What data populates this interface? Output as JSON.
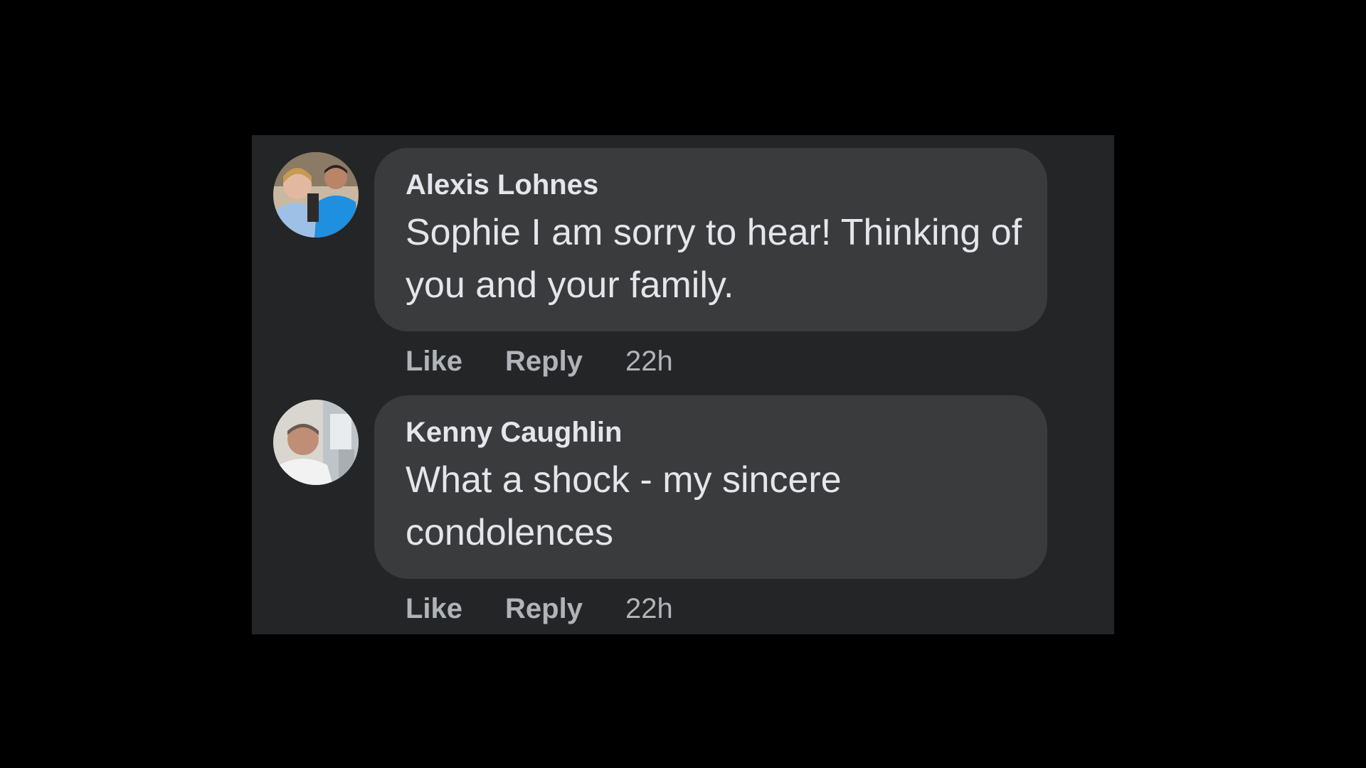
{
  "comments": [
    {
      "author": "Alexis Lohnes",
      "text": "Sophie I am sorry to hear! Thinking of you and your family.",
      "actions": {
        "like": "Like",
        "reply": "Reply",
        "time": "22h"
      },
      "avatar_icon": "profile-photo-two-people"
    },
    {
      "author": "Kenny Caughlin",
      "text": "What a shock - my sincere condolences",
      "actions": {
        "like": "Like",
        "reply": "Reply",
        "time": "22h"
      },
      "avatar_icon": "profile-photo-man"
    }
  ],
  "colors": {
    "page_background": "#000000",
    "panel_background": "#242526",
    "bubble_background": "#3a3b3c",
    "primary_text": "#e4e6eb",
    "secondary_text": "#b0b3b8"
  }
}
